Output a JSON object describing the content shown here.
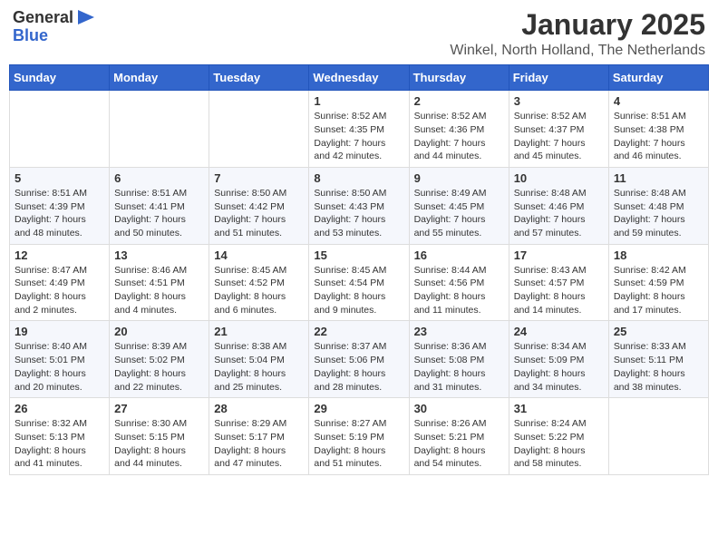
{
  "header": {
    "logo_general": "General",
    "logo_blue": "Blue",
    "month": "January 2025",
    "location": "Winkel, North Holland, The Netherlands"
  },
  "weekdays": [
    "Sunday",
    "Monday",
    "Tuesday",
    "Wednesday",
    "Thursday",
    "Friday",
    "Saturday"
  ],
  "weeks": [
    [
      {
        "day": "",
        "info": ""
      },
      {
        "day": "",
        "info": ""
      },
      {
        "day": "",
        "info": ""
      },
      {
        "day": "1",
        "info": "Sunrise: 8:52 AM\nSunset: 4:35 PM\nDaylight: 7 hours\nand 42 minutes."
      },
      {
        "day": "2",
        "info": "Sunrise: 8:52 AM\nSunset: 4:36 PM\nDaylight: 7 hours\nand 44 minutes."
      },
      {
        "day": "3",
        "info": "Sunrise: 8:52 AM\nSunset: 4:37 PM\nDaylight: 7 hours\nand 45 minutes."
      },
      {
        "day": "4",
        "info": "Sunrise: 8:51 AM\nSunset: 4:38 PM\nDaylight: 7 hours\nand 46 minutes."
      }
    ],
    [
      {
        "day": "5",
        "info": "Sunrise: 8:51 AM\nSunset: 4:39 PM\nDaylight: 7 hours\nand 48 minutes."
      },
      {
        "day": "6",
        "info": "Sunrise: 8:51 AM\nSunset: 4:41 PM\nDaylight: 7 hours\nand 50 minutes."
      },
      {
        "day": "7",
        "info": "Sunrise: 8:50 AM\nSunset: 4:42 PM\nDaylight: 7 hours\nand 51 minutes."
      },
      {
        "day": "8",
        "info": "Sunrise: 8:50 AM\nSunset: 4:43 PM\nDaylight: 7 hours\nand 53 minutes."
      },
      {
        "day": "9",
        "info": "Sunrise: 8:49 AM\nSunset: 4:45 PM\nDaylight: 7 hours\nand 55 minutes."
      },
      {
        "day": "10",
        "info": "Sunrise: 8:48 AM\nSunset: 4:46 PM\nDaylight: 7 hours\nand 57 minutes."
      },
      {
        "day": "11",
        "info": "Sunrise: 8:48 AM\nSunset: 4:48 PM\nDaylight: 7 hours\nand 59 minutes."
      }
    ],
    [
      {
        "day": "12",
        "info": "Sunrise: 8:47 AM\nSunset: 4:49 PM\nDaylight: 8 hours\nand 2 minutes."
      },
      {
        "day": "13",
        "info": "Sunrise: 8:46 AM\nSunset: 4:51 PM\nDaylight: 8 hours\nand 4 minutes."
      },
      {
        "day": "14",
        "info": "Sunrise: 8:45 AM\nSunset: 4:52 PM\nDaylight: 8 hours\nand 6 minutes."
      },
      {
        "day": "15",
        "info": "Sunrise: 8:45 AM\nSunset: 4:54 PM\nDaylight: 8 hours\nand 9 minutes."
      },
      {
        "day": "16",
        "info": "Sunrise: 8:44 AM\nSunset: 4:56 PM\nDaylight: 8 hours\nand 11 minutes."
      },
      {
        "day": "17",
        "info": "Sunrise: 8:43 AM\nSunset: 4:57 PM\nDaylight: 8 hours\nand 14 minutes."
      },
      {
        "day": "18",
        "info": "Sunrise: 8:42 AM\nSunset: 4:59 PM\nDaylight: 8 hours\nand 17 minutes."
      }
    ],
    [
      {
        "day": "19",
        "info": "Sunrise: 8:40 AM\nSunset: 5:01 PM\nDaylight: 8 hours\nand 20 minutes."
      },
      {
        "day": "20",
        "info": "Sunrise: 8:39 AM\nSunset: 5:02 PM\nDaylight: 8 hours\nand 22 minutes."
      },
      {
        "day": "21",
        "info": "Sunrise: 8:38 AM\nSunset: 5:04 PM\nDaylight: 8 hours\nand 25 minutes."
      },
      {
        "day": "22",
        "info": "Sunrise: 8:37 AM\nSunset: 5:06 PM\nDaylight: 8 hours\nand 28 minutes."
      },
      {
        "day": "23",
        "info": "Sunrise: 8:36 AM\nSunset: 5:08 PM\nDaylight: 8 hours\nand 31 minutes."
      },
      {
        "day": "24",
        "info": "Sunrise: 8:34 AM\nSunset: 5:09 PM\nDaylight: 8 hours\nand 34 minutes."
      },
      {
        "day": "25",
        "info": "Sunrise: 8:33 AM\nSunset: 5:11 PM\nDaylight: 8 hours\nand 38 minutes."
      }
    ],
    [
      {
        "day": "26",
        "info": "Sunrise: 8:32 AM\nSunset: 5:13 PM\nDaylight: 8 hours\nand 41 minutes."
      },
      {
        "day": "27",
        "info": "Sunrise: 8:30 AM\nSunset: 5:15 PM\nDaylight: 8 hours\nand 44 minutes."
      },
      {
        "day": "28",
        "info": "Sunrise: 8:29 AM\nSunset: 5:17 PM\nDaylight: 8 hours\nand 47 minutes."
      },
      {
        "day": "29",
        "info": "Sunrise: 8:27 AM\nSunset: 5:19 PM\nDaylight: 8 hours\nand 51 minutes."
      },
      {
        "day": "30",
        "info": "Sunrise: 8:26 AM\nSunset: 5:21 PM\nDaylight: 8 hours\nand 54 minutes."
      },
      {
        "day": "31",
        "info": "Sunrise: 8:24 AM\nSunset: 5:22 PM\nDaylight: 8 hours\nand 58 minutes."
      },
      {
        "day": "",
        "info": ""
      }
    ]
  ]
}
